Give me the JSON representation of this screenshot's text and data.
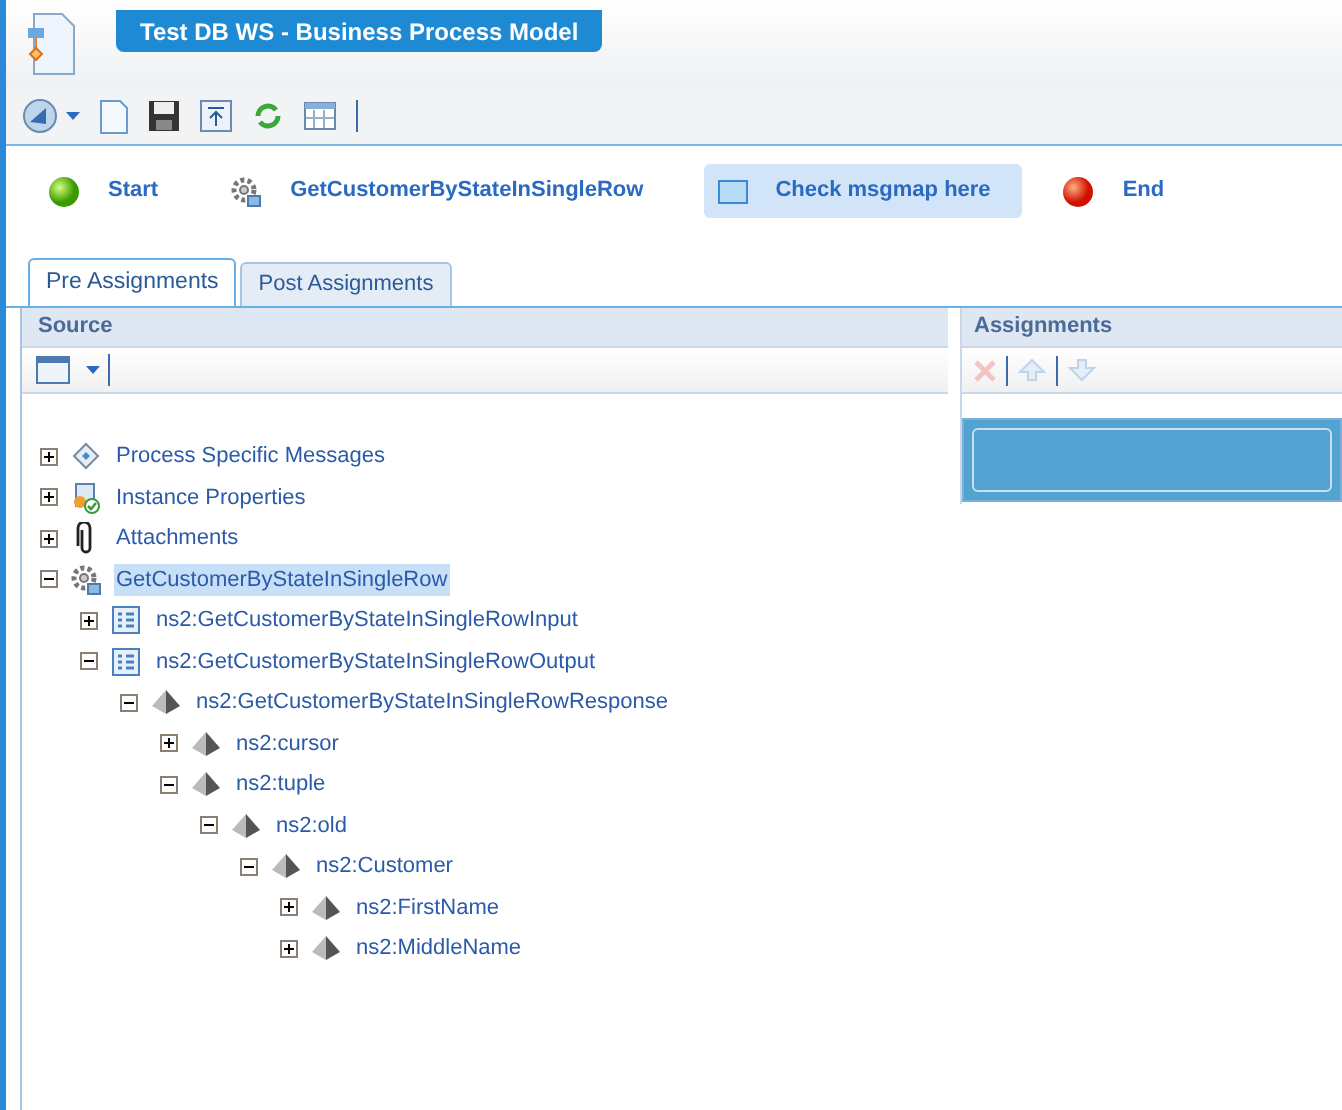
{
  "window": {
    "title": "Test DB WS - Business Process Model"
  },
  "flow": [
    {
      "kind": "start",
      "label": "Start",
      "selected": false
    },
    {
      "kind": "service",
      "label": "GetCustomerByStateInSingleRow",
      "selected": false
    },
    {
      "kind": "msgmap",
      "label": "Check msgmap here",
      "selected": true
    },
    {
      "kind": "end",
      "label": "End",
      "selected": false
    }
  ],
  "tabs": [
    {
      "label": "Pre Assignments",
      "selected": true
    },
    {
      "label": "Post Assignments",
      "selected": false
    }
  ],
  "source": {
    "title": "Source",
    "tree": [
      {
        "label": "Process Specific Messages",
        "kind": "messages",
        "expanded": false,
        "selected": false
      },
      {
        "label": "Instance Properties",
        "kind": "instance",
        "expanded": false,
        "selected": false
      },
      {
        "label": "Attachments",
        "kind": "attachment",
        "expanded": false,
        "selected": false
      },
      {
        "label": "GetCustomerByStateInSingleRow",
        "kind": "service",
        "expanded": true,
        "selected": true,
        "children": [
          {
            "label": "ns2:GetCustomerByStateInSingleRowInput",
            "kind": "message",
            "expanded": false,
            "selected": false
          },
          {
            "label": "ns2:GetCustomerByStateInSingleRowOutput",
            "kind": "message",
            "expanded": true,
            "selected": false,
            "children": [
              {
                "label": "ns2:GetCustomerByStateInSingleRowResponse",
                "kind": "element",
                "expanded": true,
                "selected": false,
                "children": [
                  {
                    "label": "ns2:cursor",
                    "kind": "element",
                    "expanded": false,
                    "selected": false
                  },
                  {
                    "label": "ns2:tuple",
                    "kind": "element",
                    "expanded": true,
                    "selected": false,
                    "children": [
                      {
                        "label": "ns2:old",
                        "kind": "element",
                        "expanded": true,
                        "selected": false,
                        "children": [
                          {
                            "label": "ns2:Customer",
                            "kind": "element",
                            "expanded": true,
                            "selected": false,
                            "children": [
                              {
                                "label": "ns2:FirstName",
                                "kind": "element",
                                "expanded": false,
                                "selected": false
                              },
                              {
                                "label": "ns2:MiddleName",
                                "kind": "element",
                                "expanded": false,
                                "selected": false
                              }
                            ]
                          }
                        ]
                      }
                    ]
                  }
                ]
              }
            ]
          }
        ]
      }
    ]
  },
  "assignments": {
    "title": "Assignments"
  }
}
